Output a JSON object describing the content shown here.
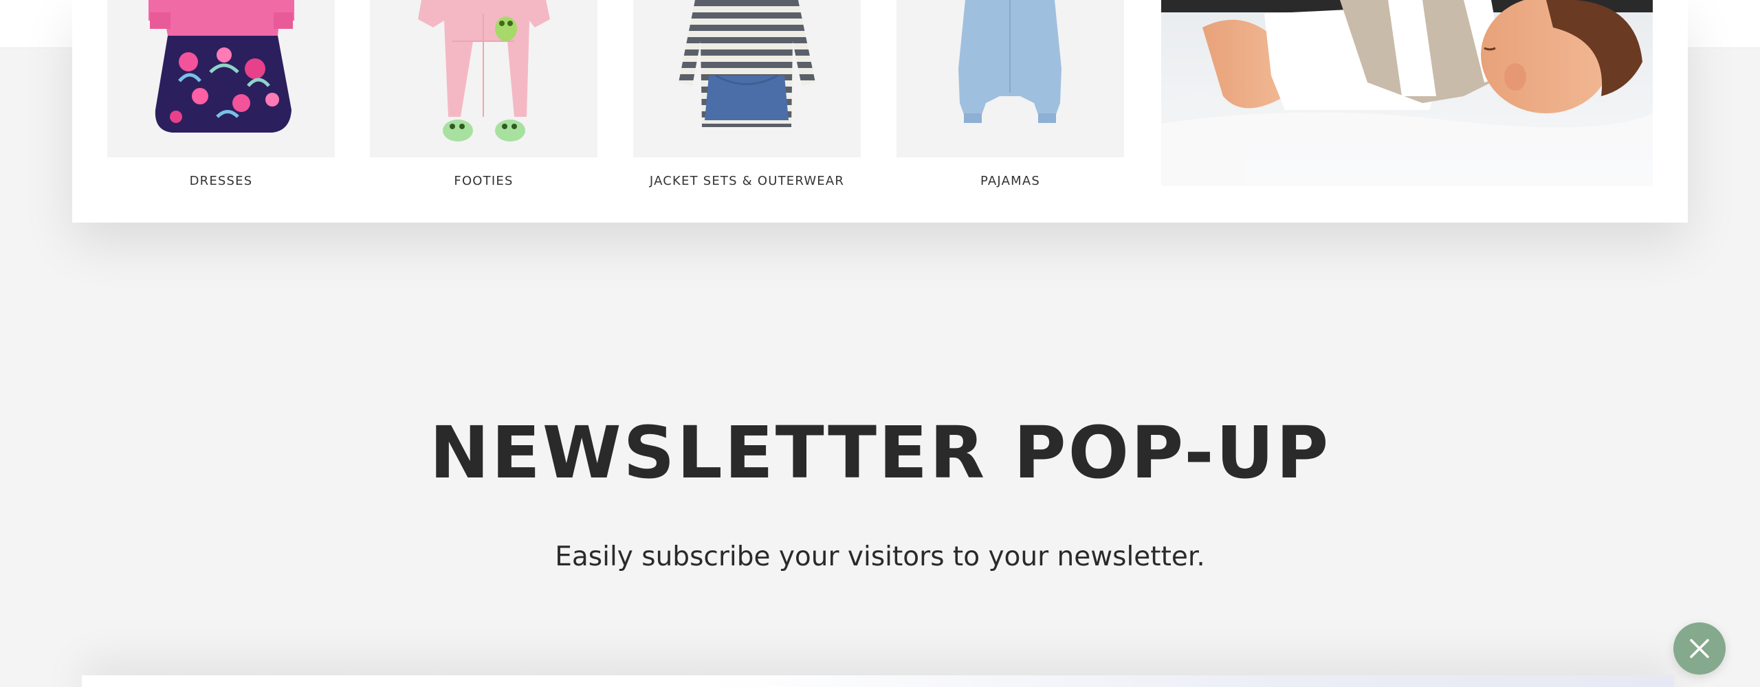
{
  "products": [
    {
      "label": "DRESSES",
      "icon": "dress-icon"
    },
    {
      "label": "FOOTIES",
      "icon": "footie-icon"
    },
    {
      "label": "JACKET SETS & OUTERWEAR",
      "icon": "hoodie-icon"
    },
    {
      "label": "PAJAMAS",
      "icon": "sleepsack-icon"
    }
  ],
  "section": {
    "title": "NEWSLETTER POP-UP",
    "subtitle": "Easily subscribe your visitors to your newsletter."
  },
  "colors": {
    "background": "#f4f4f4",
    "card": "#ffffff",
    "close_button": "#85a98c",
    "text": "#2a2a2a"
  },
  "close_button": {
    "icon": "close-icon"
  }
}
